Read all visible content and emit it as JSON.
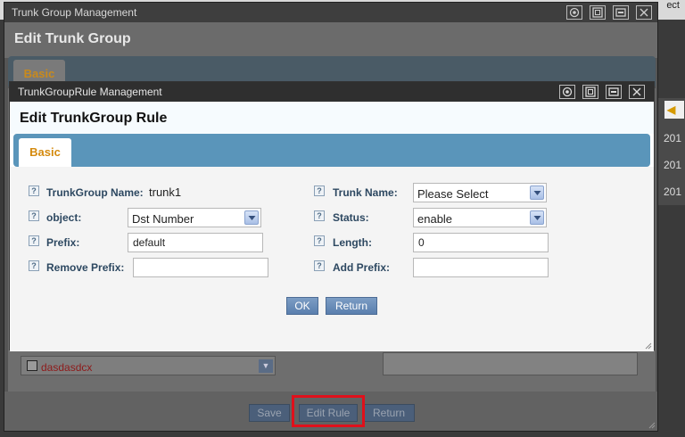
{
  "background": {
    "top_right_text": "ect",
    "dates": [
      "201",
      "201",
      "201"
    ]
  },
  "outer_dialog": {
    "window_title": "Trunk Group Management",
    "header_title": "Edit Trunk Group",
    "tab_label": "Basic",
    "list_item": "dasdasdcx",
    "buttons": {
      "save": "Save",
      "edit_rule": "Edit Rule",
      "return": "Return"
    }
  },
  "inner_dialog": {
    "window_title": "TrunkGroupRule Management",
    "header_title": "Edit TrunkGroup Rule",
    "tab_label": "Basic",
    "fields": {
      "trunkgroup_name": {
        "label": "TrunkGroup Name:",
        "value": "trunk1"
      },
      "trunk_name": {
        "label": "Trunk Name:",
        "value": "Please Select"
      },
      "object": {
        "label": "object:",
        "value": "Dst Number"
      },
      "status": {
        "label": "Status:",
        "value": "enable"
      },
      "prefix": {
        "label": "Prefix:",
        "value": "default"
      },
      "length": {
        "label": "Length:",
        "value": "0"
      },
      "remove_prefix": {
        "label": "Remove Prefix:",
        "value": ""
      },
      "add_prefix": {
        "label": "Add Prefix:",
        "value": ""
      }
    },
    "buttons": {
      "ok": "OK",
      "return": "Return"
    }
  },
  "icons": {
    "help": "?"
  },
  "colors": {
    "tab_accent": "#d48a0e",
    "tabbar_blue": "#5a95ba",
    "label_blue": "#2d4861",
    "highlight_red": "#e0101b"
  }
}
